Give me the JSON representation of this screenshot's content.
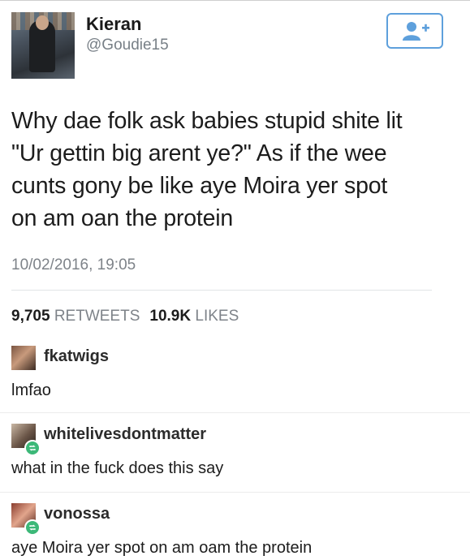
{
  "tweet": {
    "display_name": "Kieran",
    "handle": "@Goudie15",
    "text_lines": [
      "Why dae folk ask babies stupid shite lit",
      "\"Ur gettin big arent ye?\" As if the wee",
      "cunts gony be like aye Moira yer spot",
      "on am oan the protein"
    ],
    "timestamp": "10/02/2016, 19:05",
    "retweets_count": "9,705",
    "retweets_label": "RETWEETS",
    "likes_count": "10.9K",
    "likes_label": "LIKES"
  },
  "notes": [
    {
      "username": "fkatwigs",
      "body": "lmfao"
    },
    {
      "username": "whitelivesdontmatter",
      "body": "what in the fuck does this say"
    },
    {
      "username": "vonossa",
      "body": "aye Moira yer spot on am oam the protein"
    }
  ],
  "colors": {
    "follow_accent": "#5ea0dc",
    "reblog_green": "#3cb878"
  },
  "icons": {
    "follow": "add-user-icon",
    "reblog": "reblog-icon"
  }
}
